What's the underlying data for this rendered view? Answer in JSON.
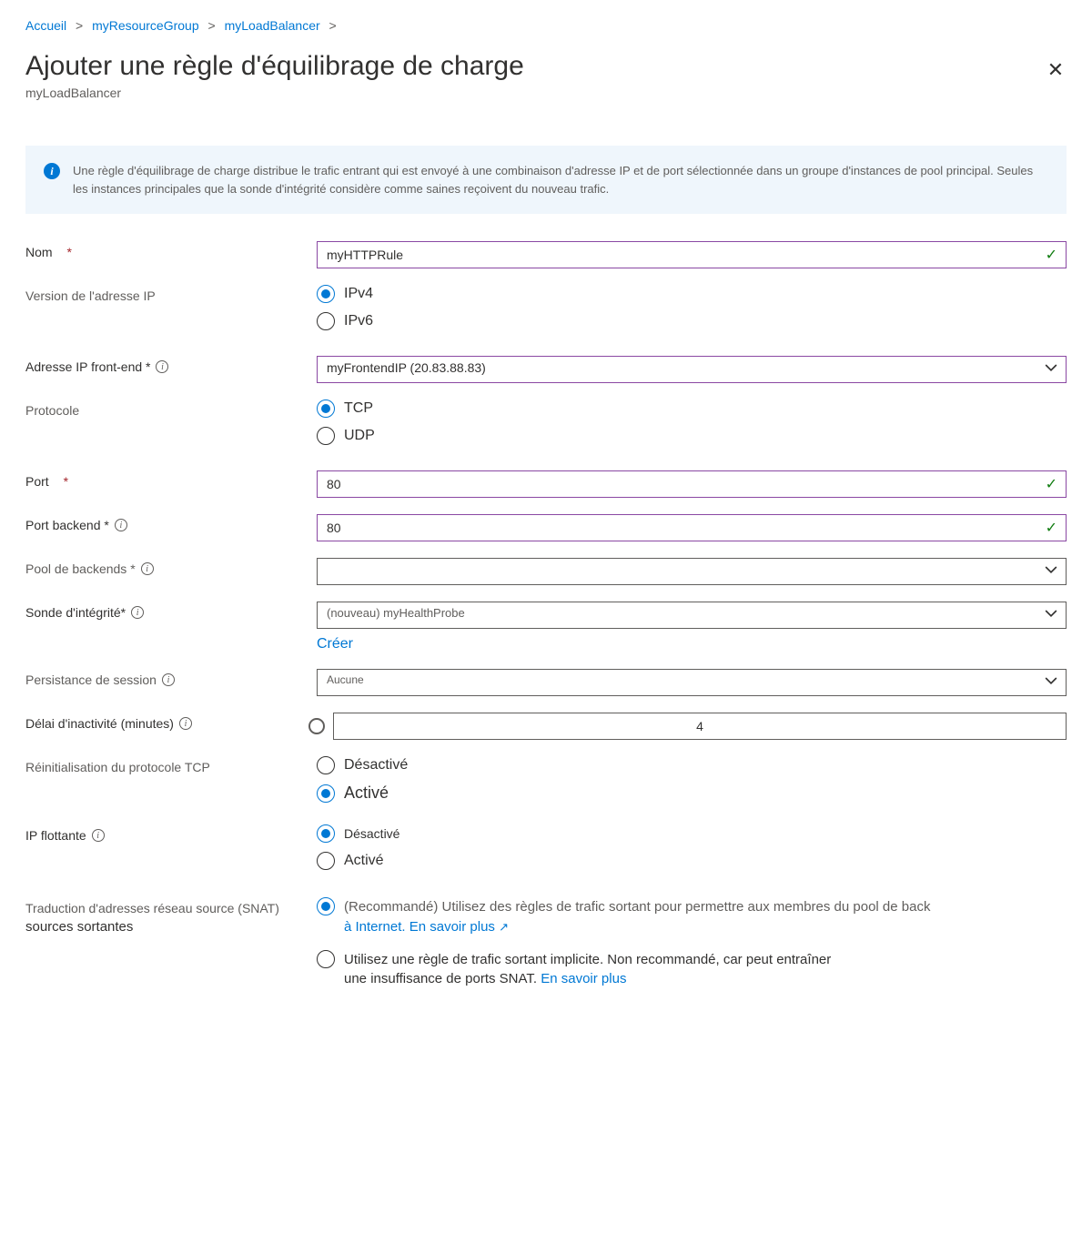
{
  "breadcrumb": {
    "home": "Accueil",
    "rg": "myResourceGroup",
    "lb": "myLoadBalancer"
  },
  "page": {
    "title": "Ajouter une règle d'équilibrage de charge",
    "subtitle": "myLoadBalancer"
  },
  "info": "Une règle d'équilibrage de charge distribue le trafic entrant qui est envoyé à une combinaison d'adresse IP et de port sélectionnée dans un groupe d'instances de pool principal. Seules les instances principales que la sonde d'intégrité considère comme saines reçoivent du nouveau trafic.",
  "labels": {
    "name": "Nom",
    "ipver": "Version de l'adresse IP",
    "frontend": "Adresse IP front-end *",
    "protocol": "Protocole",
    "port": "Port",
    "backport": "Port backend *",
    "pool": "Pool de backends *",
    "probe": "Sonde d'intégrité*",
    "create": "Créer",
    "persist": "Persistance de session",
    "idle": "Délai d'inactivité (minutes)",
    "tcpreset": "Réinitialisation du protocole TCP",
    "floating": "IP flottante",
    "snat1": "Traduction d'adresses réseau source (SNAT)",
    "snat2": "sources sortantes"
  },
  "values": {
    "name": "myHTTPRule",
    "ipv4": "IPv4",
    "ipv6": "IPv6",
    "frontend": "myFrontendIP (20.83.88.83)",
    "tcp": "TCP",
    "udp": "UDP",
    "port": "80",
    "backport": "80",
    "probe": "(nouveau) myHealthProbe",
    "persist": "Aucune",
    "idle": "4",
    "disabled": "Désactivé",
    "enabled": "Activé",
    "disabled_sm": "Désactivé",
    "enabled_sm": "Activé"
  },
  "snat": {
    "opt1a": "(Recommandé) Utilisez des règles de trafic sortant pour permettre aux membres du pool de back",
    "opt1b": "à Internet. En savoir plus",
    "opt2a": "Utilisez une règle de trafic sortant implicite. Non recommandé, car peut entraîner",
    "opt2b": "une insuffisance de ports SNAT. En savoir plus"
  }
}
